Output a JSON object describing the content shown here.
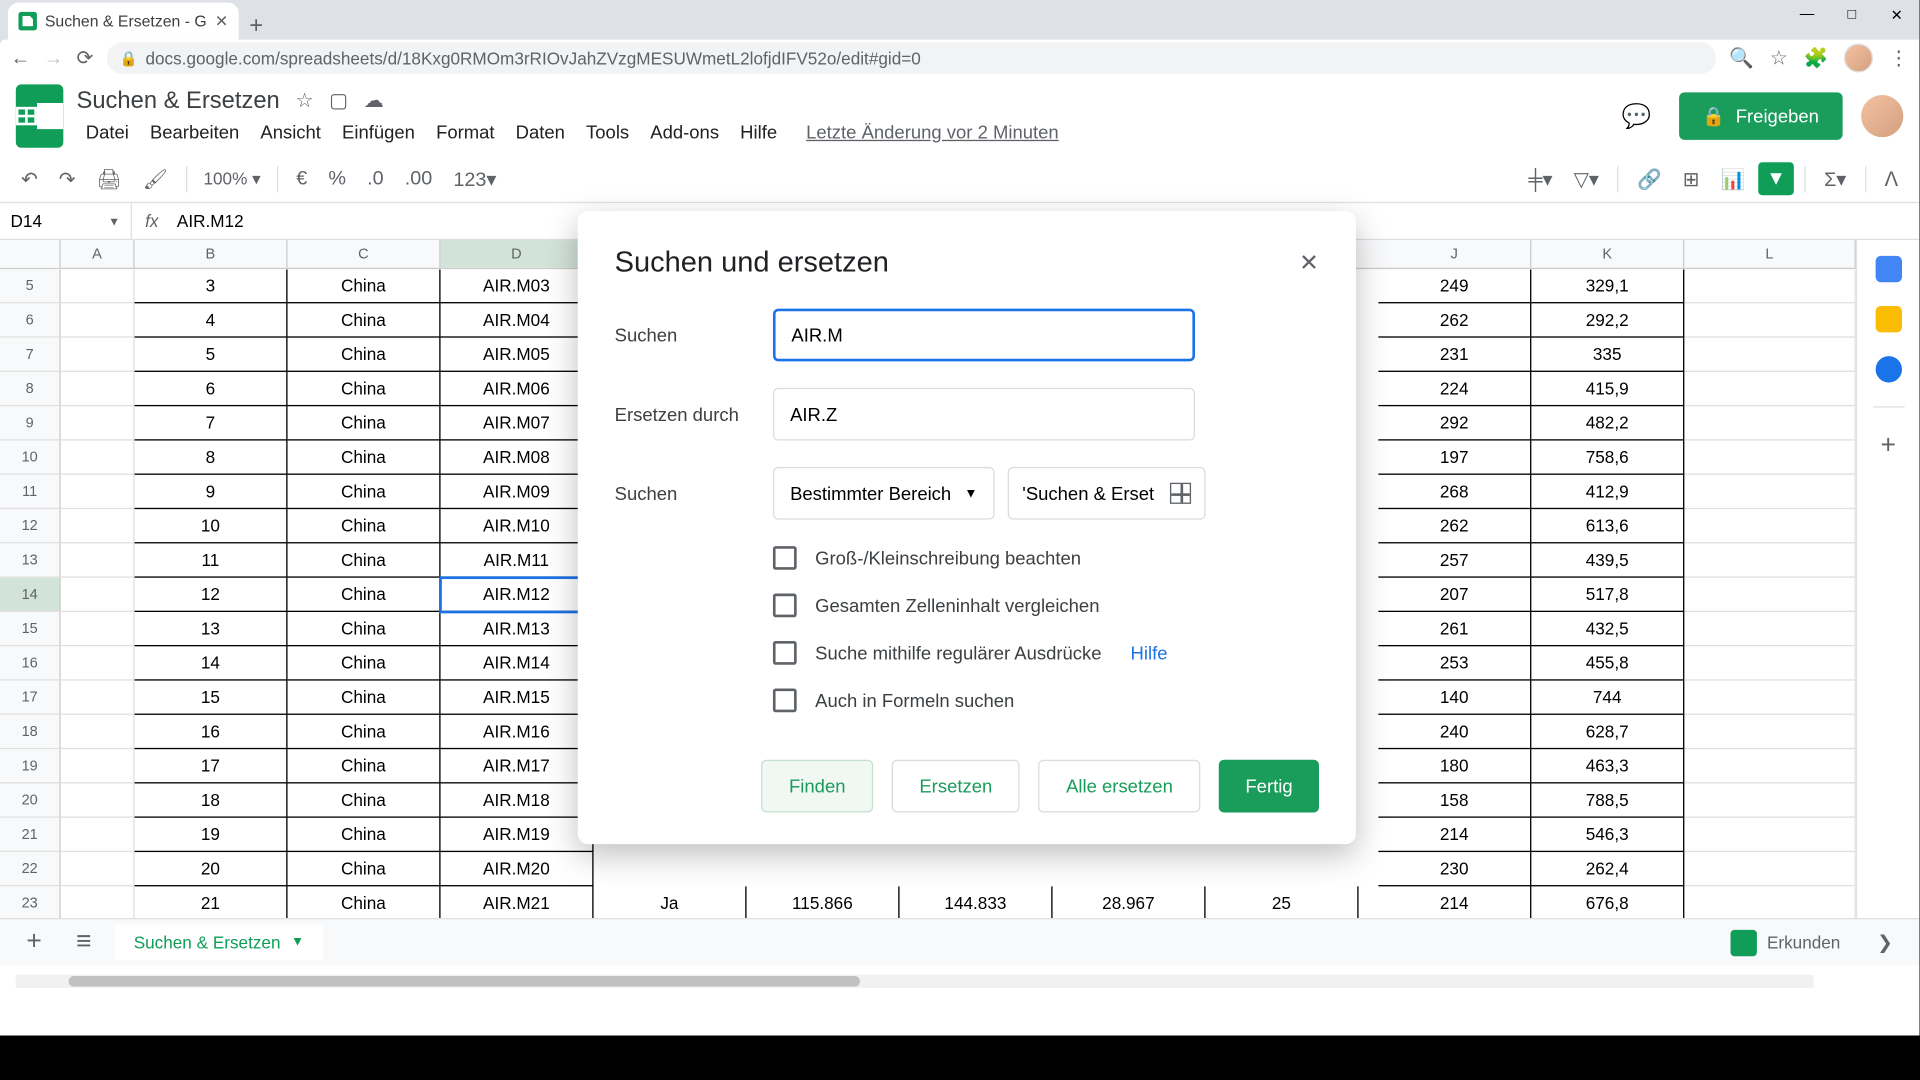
{
  "browser": {
    "tab_title": "Suchen & Ersetzen - Google Tabe",
    "url": "docs.google.com/spreadsheets/d/18Kxg0RMOm3rRIOvJahZVzgMESUWmetL2lofjdIFV52o/edit#gid=0"
  },
  "doc": {
    "title": "Suchen & Ersetzen",
    "last_edit": "Letzte Änderung vor 2 Minuten"
  },
  "menu": {
    "datei": "Datei",
    "bearbeiten": "Bearbeiten",
    "ansicht": "Ansicht",
    "einfuegen": "Einfügen",
    "format": "Format",
    "daten": "Daten",
    "tools": "Tools",
    "addons": "Add-ons",
    "hilfe": "Hilfe"
  },
  "share_label": "Freigeben",
  "toolbar": {
    "zoom": "100%",
    "fmt_currency": "€",
    "fmt_pct": "%",
    "fmt_dec0": ".0",
    "fmt_dec00": ".00",
    "fmt_123": "123"
  },
  "formula": {
    "cell_ref": "D14",
    "fx": "fx",
    "value": "AIR.M12"
  },
  "columns_left": [
    "A",
    "B",
    "C",
    "D"
  ],
  "columns_right": [
    "J",
    "K",
    "L"
  ],
  "rows": [
    {
      "n": 5,
      "b": "3",
      "c": "China",
      "d": "AIR.M03",
      "j": "249",
      "k": "329,1"
    },
    {
      "n": 6,
      "b": "4",
      "c": "China",
      "d": "AIR.M04",
      "j": "262",
      "k": "292,2"
    },
    {
      "n": 7,
      "b": "5",
      "c": "China",
      "d": "AIR.M05",
      "j": "231",
      "k": "335"
    },
    {
      "n": 8,
      "b": "6",
      "c": "China",
      "d": "AIR.M06",
      "j": "224",
      "k": "415,9"
    },
    {
      "n": 9,
      "b": "7",
      "c": "China",
      "d": "AIR.M07",
      "j": "292",
      "k": "482,2"
    },
    {
      "n": 10,
      "b": "8",
      "c": "China",
      "d": "AIR.M08",
      "j": "197",
      "k": "758,6"
    },
    {
      "n": 11,
      "b": "9",
      "c": "China",
      "d": "AIR.M09",
      "j": "268",
      "k": "412,9"
    },
    {
      "n": 12,
      "b": "10",
      "c": "China",
      "d": "AIR.M10",
      "j": "262",
      "k": "613,6"
    },
    {
      "n": 13,
      "b": "11",
      "c": "China",
      "d": "AIR.M11",
      "j": "257",
      "k": "439,5"
    },
    {
      "n": 14,
      "b": "12",
      "c": "China",
      "d": "AIR.M12",
      "j": "207",
      "k": "517,8"
    },
    {
      "n": 15,
      "b": "13",
      "c": "China",
      "d": "AIR.M13",
      "j": "261",
      "k": "432,5"
    },
    {
      "n": 16,
      "b": "14",
      "c": "China",
      "d": "AIR.M14",
      "j": "253",
      "k": "455,8"
    },
    {
      "n": 17,
      "b": "15",
      "c": "China",
      "d": "AIR.M15",
      "j": "140",
      "k": "744"
    },
    {
      "n": 18,
      "b": "16",
      "c": "China",
      "d": "AIR.M16",
      "j": "240",
      "k": "628,7"
    },
    {
      "n": 19,
      "b": "17",
      "c": "China",
      "d": "AIR.M17",
      "j": "180",
      "k": "463,3"
    },
    {
      "n": 20,
      "b": "18",
      "c": "China",
      "d": "AIR.M18",
      "j": "158",
      "k": "788,5"
    },
    {
      "n": 21,
      "b": "19",
      "c": "China",
      "d": "AIR.M19",
      "j": "214",
      "k": "546,3"
    },
    {
      "n": 22,
      "b": "20",
      "c": "China",
      "d": "AIR.M20",
      "j": "230",
      "k": "262,4"
    },
    {
      "n": 23,
      "b": "21",
      "c": "China",
      "d": "AIR.M21",
      "j": "214",
      "k": "676,8"
    }
  ],
  "row23_extra": {
    "e": "Ja",
    "f": "115.866",
    "g": "144.833",
    "h": "28.967",
    "i": "25"
  },
  "dialog": {
    "title": "Suchen und ersetzen",
    "search_label": "Suchen",
    "search_value": "AIR.M",
    "replace_label": "Ersetzen durch",
    "replace_value": "AIR.Z",
    "scope_label": "Suchen",
    "scope_value": "Bestimmter Bereich",
    "range_value": "'Suchen & Erset",
    "cb_case": "Groß-/Kleinschreibung beachten",
    "cb_whole": "Gesamten Zelleninhalt vergleichen",
    "cb_regex": "Suche mithilfe regulärer Ausdrücke",
    "help": "Hilfe",
    "cb_formulas": "Auch in Formeln suchen",
    "btn_find": "Finden",
    "btn_replace": "Ersetzen",
    "btn_replace_all": "Alle ersetzen",
    "btn_done": "Fertig"
  },
  "sheet_tab": "Suchen & Ersetzen",
  "explore": "Erkunden"
}
